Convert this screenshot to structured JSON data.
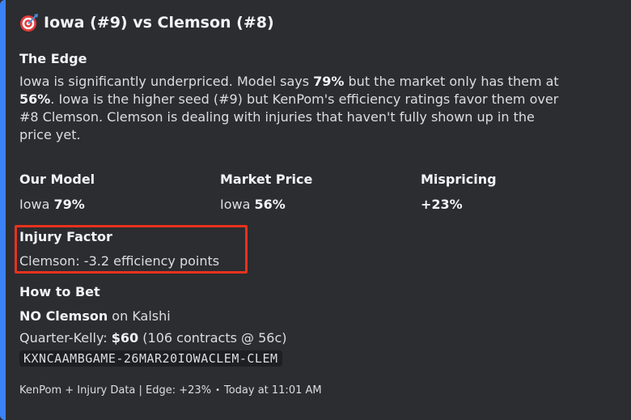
{
  "embed": {
    "accent_color": "#3b82f6",
    "title_icon": "direct-hit-icon",
    "title": "Iowa (#9) vs Clemson (#8)"
  },
  "edge": {
    "heading": "The Edge",
    "line1_a": "Iowa is significantly underpriced. Model says ",
    "line1_bold": "79%",
    "line1_b": " but the market only has them at",
    "line2_bold": "56%",
    "line2_rest": ". Iowa is the higher seed (#9) but KenPom's efficiency ratings favor them over",
    "line3": "#8 Clemson. Clemson is dealing with injuries that haven't fully shown up in the",
    "line4": "price yet."
  },
  "fields": {
    "our_model": {
      "label": "Our Model",
      "team": "Iowa ",
      "value": "79%"
    },
    "market_price": {
      "label": "Market Price",
      "team": "Iowa ",
      "value": "56%"
    },
    "mispricing": {
      "label": "Mispricing",
      "value": "+23%"
    }
  },
  "injury": {
    "label": "Injury Factor",
    "value": "Clemson: -3.2 efficiency points",
    "highlight_color": "#e8321c"
  },
  "how_to_bet": {
    "label": "How to Bet",
    "action_bold": "NO Clemson",
    "action_rest": " on Kalshi",
    "kelly_prefix": "Quarter-Kelly: ",
    "kelly_bold": "$60",
    "kelly_rest": " (106 contracts @ 56c)",
    "ticker": "KXNCAAMBGAME-26MAR20IOWACLEM-CLEM"
  },
  "footer": {
    "source": "KenPom + Injury Data | Edge: +23%",
    "separator": "•",
    "timestamp": "Today at 11:01 AM"
  }
}
